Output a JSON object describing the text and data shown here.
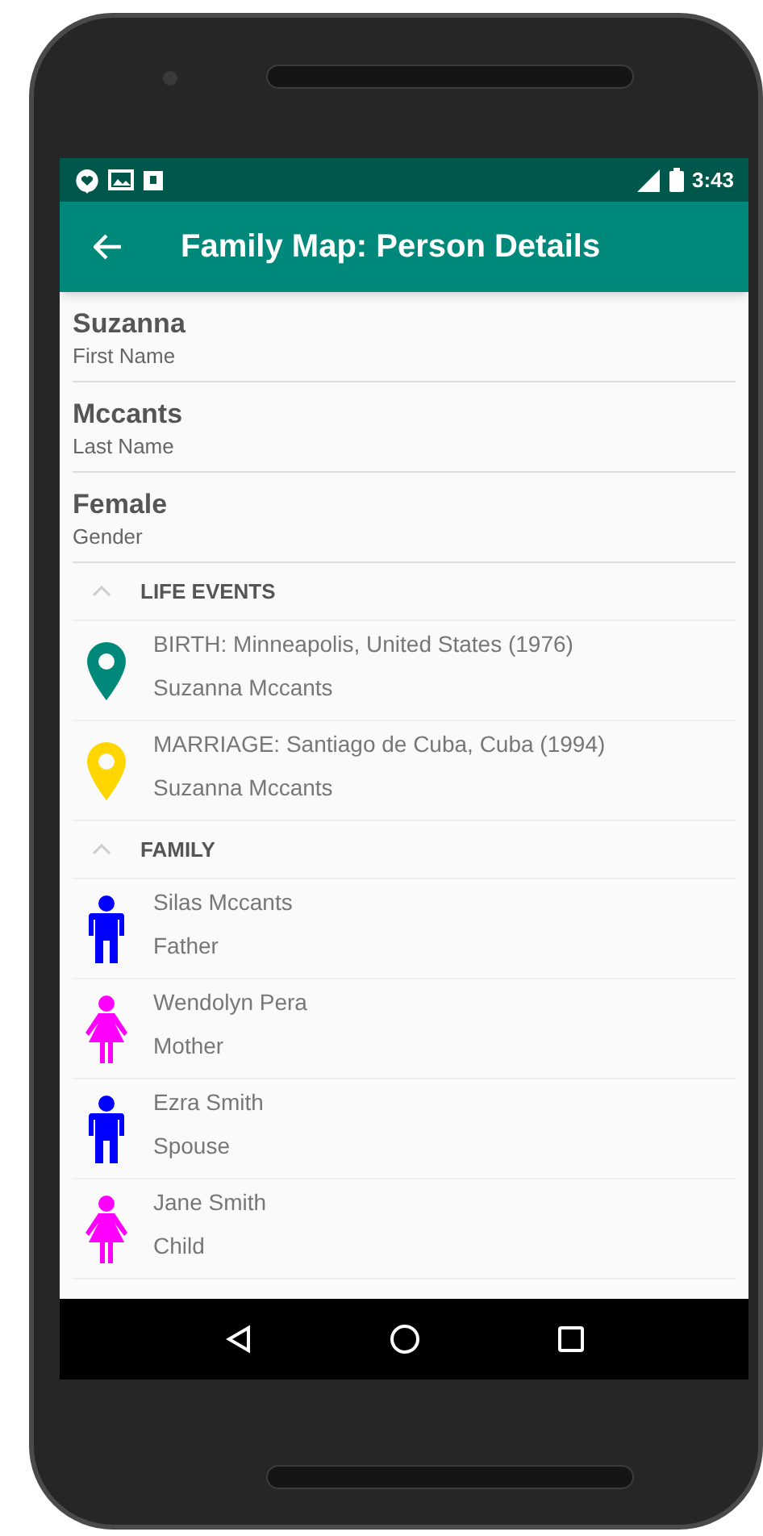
{
  "status_bar": {
    "time": "3:43"
  },
  "toolbar": {
    "title": "Family Map: Person Details"
  },
  "fields": [
    {
      "value": "Suzanna",
      "label": "First Name"
    },
    {
      "value": "Mccants",
      "label": "Last Name"
    },
    {
      "value": "Female",
      "label": "Gender"
    }
  ],
  "sections": [
    {
      "title": "LIFE EVENTS",
      "expanded": true,
      "items": [
        {
          "kind": "event",
          "color": "#00897b",
          "line1": "BIRTH: Minneapolis, United States (1976)",
          "line2": "Suzanna Mccants"
        },
        {
          "kind": "event",
          "color": "#ffd600",
          "line1": "MARRIAGE: Santiago de Cuba, Cuba (1994)",
          "line2": "Suzanna Mccants"
        }
      ]
    },
    {
      "title": "FAMILY",
      "expanded": true,
      "items": [
        {
          "kind": "male",
          "color": "#0000ff",
          "line1": "Silas Mccants",
          "line2": "Father"
        },
        {
          "kind": "female",
          "color": "#ff00ff",
          "line1": "Wendolyn Pera",
          "line2": "Mother"
        },
        {
          "kind": "male",
          "color": "#0000ff",
          "line1": "Ezra Smith",
          "line2": "Spouse"
        },
        {
          "kind": "female",
          "color": "#ff00ff",
          "line1": "Jane Smith",
          "line2": "Child"
        }
      ]
    }
  ]
}
